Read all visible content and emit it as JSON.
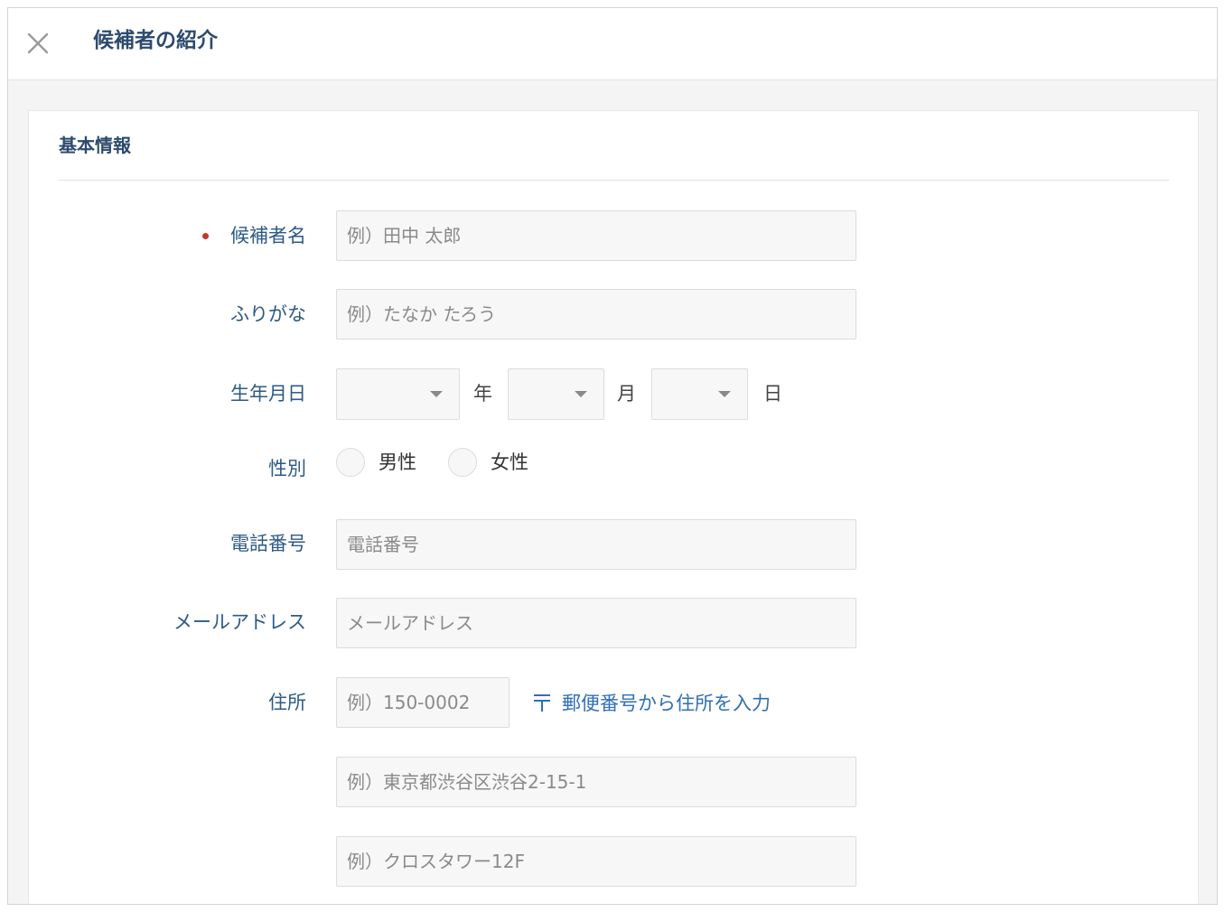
{
  "header": {
    "title": "候補者の紹介"
  },
  "section": {
    "title": "基本情報"
  },
  "form": {
    "name": {
      "label": "候補者名",
      "placeholder": "例）田中 太郎",
      "required": true
    },
    "furigana": {
      "label": "ふりがな",
      "placeholder": "例）たなか たろう"
    },
    "birthday": {
      "label": "生年月日",
      "year_unit": "年",
      "month_unit": "月",
      "day_unit": "日",
      "year_value": "",
      "month_value": "",
      "day_value": ""
    },
    "gender": {
      "label": "性別",
      "options": [
        "男性",
        "女性"
      ]
    },
    "phone": {
      "label": "電話番号",
      "placeholder": "電話番号"
    },
    "email": {
      "label": "メールアドレス",
      "placeholder": "メールアドレス"
    },
    "address": {
      "label": "住所",
      "postal_placeholder": "例）150-0002",
      "postal_lookup_label": "郵便番号から住所を入力",
      "line1_placeholder": "例）東京都渋谷区渋谷2-15-1",
      "line2_placeholder": "例）クロスタワー12F"
    }
  },
  "colors": {
    "label": "#2d5a86",
    "title": "#2d4a6e",
    "required": "#c0392b",
    "link": "#2f6fb5"
  }
}
